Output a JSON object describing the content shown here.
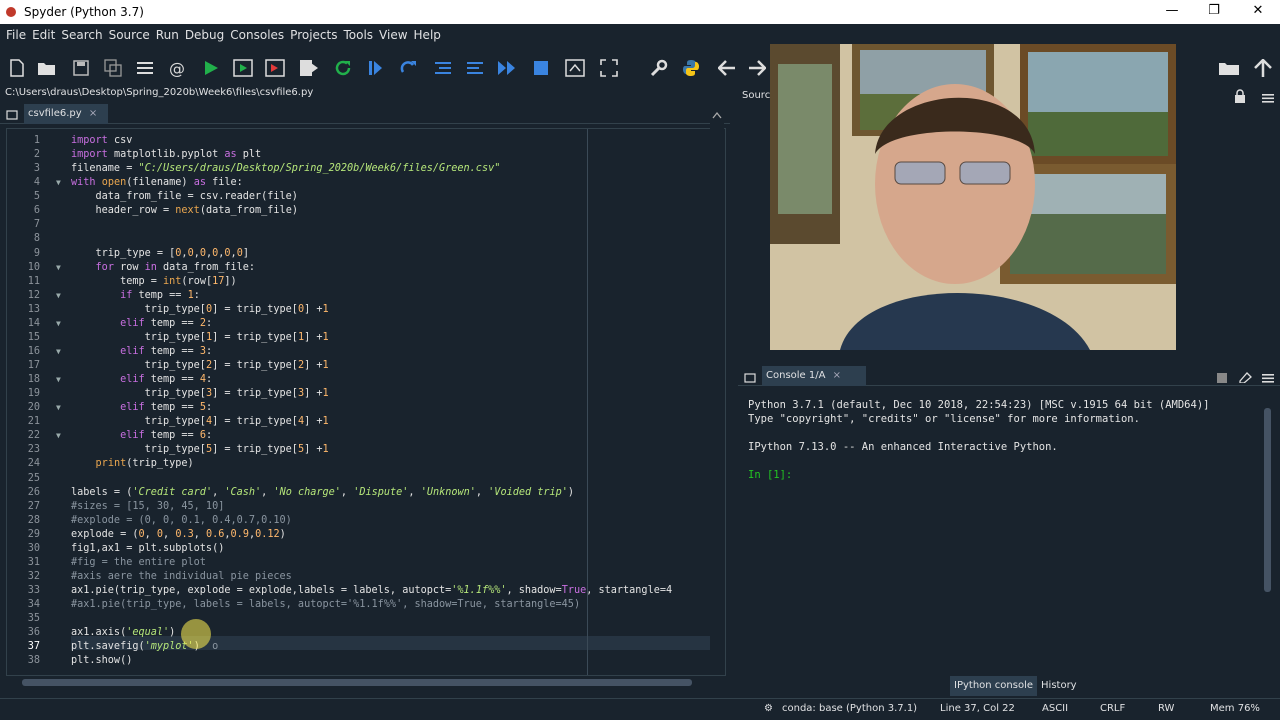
{
  "window": {
    "title": "Spyder (Python 3.7)",
    "min": "—",
    "max": "❐",
    "close": "✕"
  },
  "menu": [
    "File",
    "Edit",
    "Search",
    "Source",
    "Run",
    "Debug",
    "Consoles",
    "Projects",
    "Tools",
    "View",
    "Help"
  ],
  "path": "C:\\Users\\draus\\Desktop\\Spring_2020b\\Week6\\files\\csvfile6.py",
  "editor_tab": {
    "label": "csvfile6.py",
    "close": "×"
  },
  "source_label": "Source",
  "code_lines": [
    [
      [
        "kw",
        "import"
      ],
      [
        "op",
        " csv"
      ]
    ],
    [
      [
        "kw",
        "import"
      ],
      [
        "op",
        " matplotlib.pyplot "
      ],
      [
        "kw",
        "as"
      ],
      [
        "op",
        " plt"
      ]
    ],
    [
      [
        "op",
        "filename = "
      ],
      [
        "str",
        "\"C:/Users/draus/Desktop/Spring_2020b/Week6/files/Green.csv\""
      ]
    ],
    [
      [
        "kw",
        "with"
      ],
      [
        "op",
        " "
      ],
      [
        "bi",
        "open"
      ],
      [
        "op",
        "(filename) "
      ],
      [
        "kw",
        "as"
      ],
      [
        "op",
        " file:"
      ]
    ],
    [
      [
        "op",
        "    data_from_file = csv.reader(file)"
      ]
    ],
    [
      [
        "op",
        "    header_row = "
      ],
      [
        "bi",
        "next"
      ],
      [
        "op",
        "(data_from_file)"
      ]
    ],
    [
      [
        "op",
        ""
      ]
    ],
    [
      [
        "op",
        ""
      ]
    ],
    [
      [
        "op",
        "    trip_type = ["
      ],
      [
        "num",
        "0"
      ],
      [
        "op",
        ","
      ],
      [
        "num",
        "0"
      ],
      [
        "op",
        ","
      ],
      [
        "num",
        "0"
      ],
      [
        "op",
        ","
      ],
      [
        "num",
        "0"
      ],
      [
        "op",
        ","
      ],
      [
        "num",
        "0"
      ],
      [
        "op",
        ","
      ],
      [
        "num",
        "0"
      ],
      [
        "op",
        "]"
      ]
    ],
    [
      [
        "op",
        "    "
      ],
      [
        "kw",
        "for"
      ],
      [
        "op",
        " row "
      ],
      [
        "kw",
        "in"
      ],
      [
        "op",
        " data_from_file:"
      ]
    ],
    [
      [
        "op",
        "        temp = "
      ],
      [
        "bi",
        "int"
      ],
      [
        "op",
        "(row["
      ],
      [
        "num",
        "17"
      ],
      [
        "op",
        "])"
      ]
    ],
    [
      [
        "op",
        "        "
      ],
      [
        "kw",
        "if"
      ],
      [
        "op",
        " temp == "
      ],
      [
        "num",
        "1"
      ],
      [
        "op",
        ":"
      ]
    ],
    [
      [
        "op",
        "            trip_type["
      ],
      [
        "num",
        "0"
      ],
      [
        "op",
        "] = trip_type["
      ],
      [
        "num",
        "0"
      ],
      [
        "op",
        "] +"
      ],
      [
        "num",
        "1"
      ]
    ],
    [
      [
        "op",
        "        "
      ],
      [
        "kw",
        "elif"
      ],
      [
        "op",
        " temp == "
      ],
      [
        "num",
        "2"
      ],
      [
        "op",
        ":"
      ]
    ],
    [
      [
        "op",
        "            trip_type["
      ],
      [
        "num",
        "1"
      ],
      [
        "op",
        "] = trip_type["
      ],
      [
        "num",
        "1"
      ],
      [
        "op",
        "] +"
      ],
      [
        "num",
        "1"
      ]
    ],
    [
      [
        "op",
        "        "
      ],
      [
        "kw",
        "elif"
      ],
      [
        "op",
        " temp == "
      ],
      [
        "num",
        "3"
      ],
      [
        "op",
        ":"
      ]
    ],
    [
      [
        "op",
        "            trip_type["
      ],
      [
        "num",
        "2"
      ],
      [
        "op",
        "] = trip_type["
      ],
      [
        "num",
        "2"
      ],
      [
        "op",
        "] +"
      ],
      [
        "num",
        "1"
      ]
    ],
    [
      [
        "op",
        "        "
      ],
      [
        "kw",
        "elif"
      ],
      [
        "op",
        " temp == "
      ],
      [
        "num",
        "4"
      ],
      [
        "op",
        ":"
      ]
    ],
    [
      [
        "op",
        "            trip_type["
      ],
      [
        "num",
        "3"
      ],
      [
        "op",
        "] = trip_type["
      ],
      [
        "num",
        "3"
      ],
      [
        "op",
        "] +"
      ],
      [
        "num",
        "1"
      ]
    ],
    [
      [
        "op",
        "        "
      ],
      [
        "kw",
        "elif"
      ],
      [
        "op",
        " temp == "
      ],
      [
        "num",
        "5"
      ],
      [
        "op",
        ":"
      ]
    ],
    [
      [
        "op",
        "            trip_type["
      ],
      [
        "num",
        "4"
      ],
      [
        "op",
        "] = trip_type["
      ],
      [
        "num",
        "4"
      ],
      [
        "op",
        "] +"
      ],
      [
        "num",
        "1"
      ]
    ],
    [
      [
        "op",
        "        "
      ],
      [
        "kw",
        "elif"
      ],
      [
        "op",
        " temp == "
      ],
      [
        "num",
        "6"
      ],
      [
        "op",
        ":"
      ]
    ],
    [
      [
        "op",
        "            trip_type["
      ],
      [
        "num",
        "5"
      ],
      [
        "op",
        "] = trip_type["
      ],
      [
        "num",
        "5"
      ],
      [
        "op",
        "] +"
      ],
      [
        "num",
        "1"
      ]
    ],
    [
      [
        "op",
        "    "
      ],
      [
        "bi",
        "print"
      ],
      [
        "op",
        "(trip_type)"
      ]
    ],
    [
      [
        "op",
        ""
      ]
    ],
    [
      [
        "op",
        "labels = ("
      ],
      [
        "str",
        "'Credit card'"
      ],
      [
        "op",
        ", "
      ],
      [
        "str",
        "'Cash'"
      ],
      [
        "op",
        ", "
      ],
      [
        "str",
        "'No charge'"
      ],
      [
        "op",
        ", "
      ],
      [
        "str",
        "'Dispute'"
      ],
      [
        "op",
        ", "
      ],
      [
        "str",
        "'Unknown'"
      ],
      [
        "op",
        ", "
      ],
      [
        "str",
        "'Voided trip'"
      ],
      [
        "op",
        ")"
      ]
    ],
    [
      [
        "cm",
        "#sizes = [15, 30, 45, 10]"
      ]
    ],
    [
      [
        "cm",
        "#explode = (0, 0, 0.1, 0.4,0.7,0.10)"
      ]
    ],
    [
      [
        "op",
        "explode = ("
      ],
      [
        "num",
        "0"
      ],
      [
        "op",
        ", "
      ],
      [
        "num",
        "0"
      ],
      [
        "op",
        ", "
      ],
      [
        "num",
        "0.3"
      ],
      [
        "op",
        ", "
      ],
      [
        "num",
        "0.6"
      ],
      [
        "op",
        ","
      ],
      [
        "num",
        "0.9"
      ],
      [
        "op",
        ","
      ],
      [
        "num",
        "0.12"
      ],
      [
        "op",
        ")"
      ]
    ],
    [
      [
        "op",
        "fig1,ax1 = plt.subplots()"
      ]
    ],
    [
      [
        "cm",
        "#fig = the entire plot"
      ]
    ],
    [
      [
        "cm",
        "#axis aere the individual pie pieces"
      ]
    ],
    [
      [
        "op",
        "ax1.pie(trip_type, explode = explode,labels = labels, autopct="
      ],
      [
        "str",
        "'%1.1f%%'"
      ],
      [
        "op",
        ", shadow="
      ],
      [
        "kw",
        "True"
      ],
      [
        "op",
        ", startangle=4"
      ]
    ],
    [
      [
        "cm",
        "#ax1.pie(trip_type, labels = labels, autopct='%1.1f%%', shadow=True, startangle=45)"
      ]
    ],
    [
      [
        "op",
        ""
      ]
    ],
    [
      [
        "op",
        "ax1.axis("
      ],
      [
        "str",
        "'equal'"
      ],
      [
        "op",
        ")"
      ]
    ],
    [
      [
        "op",
        "plt.savefig("
      ],
      [
        "str",
        "'myplot'"
      ],
      [
        "op",
        ")  "
      ],
      [
        "cm",
        "o"
      ]
    ],
    [
      [
        "op",
        "plt.show()"
      ]
    ]
  ],
  "fold_lines": [
    4,
    10,
    12,
    14,
    16,
    18,
    20,
    22
  ],
  "current_line": 37,
  "console": {
    "tab_label": "Console 1/A",
    "tab_close": "×",
    "lines": [
      "Python 3.7.1 (default, Dec 10 2018, 22:54:23) [MSC v.1915 64 bit (AMD64)]",
      "Type \"copyright\", \"credits\" or \"license\" for more information.",
      "",
      "IPython 7.13.0 -- An enhanced Interactive Python.",
      "",
      "In [1]:"
    ],
    "bottom_tabs": [
      "IPython console",
      "History"
    ]
  },
  "status": {
    "conda": "conda: base (Python 3.7.1)",
    "position": "Line 37, Col 22",
    "encoding": "ASCII",
    "eol": "CRLF",
    "rw": "RW",
    "mem": "Mem 76%"
  }
}
